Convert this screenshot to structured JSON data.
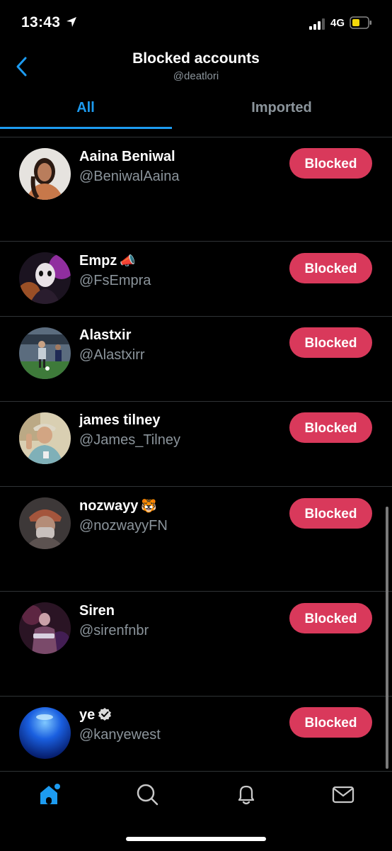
{
  "status_bar": {
    "time": "13:43",
    "network": "4G",
    "battery_color": "#f5d90a"
  },
  "header": {
    "title": "Blocked accounts",
    "subtitle": "@deatlori"
  },
  "tabs": [
    {
      "label": "All",
      "active": true
    },
    {
      "label": "Imported",
      "active": false
    }
  ],
  "accounts": [
    {
      "name": "Aaina Beniwal",
      "handle": "@BeniwalAaina",
      "button": "Blocked"
    },
    {
      "name": "Empz",
      "emoji": "📣",
      "handle": "@FsEmpra",
      "button": "Blocked"
    },
    {
      "name": "Alastxir",
      "handle": "@Alastxirr",
      "button": "Blocked"
    },
    {
      "name": "james tilney",
      "handle": "@James_Tilney",
      "button": "Blocked"
    },
    {
      "name": "nozwayy",
      "emoji": "🐯",
      "handle": "@nozwayyFN",
      "button": "Blocked"
    },
    {
      "name": "Siren",
      "handle": "@sirenfnbr",
      "button": "Blocked"
    },
    {
      "name": "ye",
      "verified": true,
      "handle": "@kanyewest",
      "button": "Blocked"
    }
  ],
  "bottom_nav": [
    "home-icon",
    "search-icon",
    "notifications-icon",
    "messages-icon"
  ],
  "colors": {
    "accent": "#1d9bf0",
    "blocked_button": "#d9395b",
    "muted_text": "#8b949b"
  }
}
